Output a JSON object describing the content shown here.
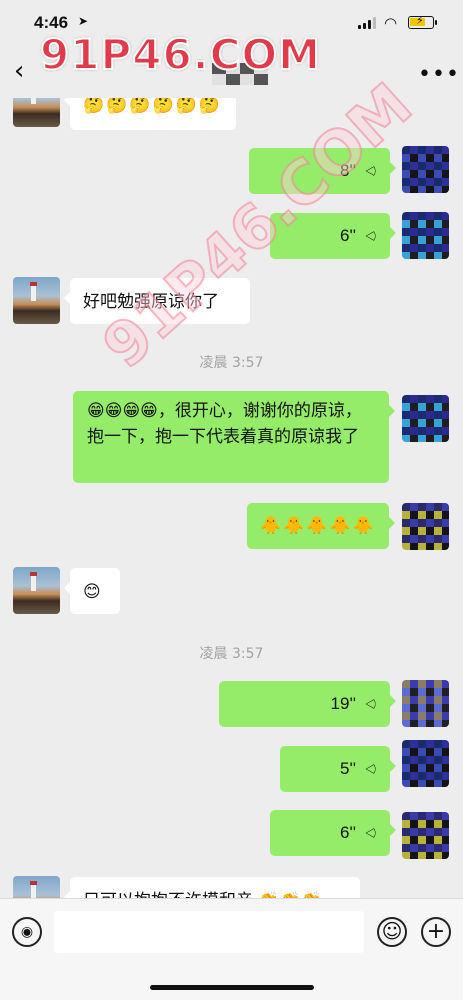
{
  "status_bar": {
    "time": "4:46",
    "location_icon": "location-arrow-icon",
    "wifi_icon": "wifi-icon",
    "battery_icon": "battery-charging-icon"
  },
  "nav": {
    "back_icon": "chevron-left-icon",
    "more_label": "•••",
    "back_label": "‹"
  },
  "watermark": {
    "main": "91P46.COM",
    "diagonal": "91P46.COM"
  },
  "messages": [
    {
      "side": "left",
      "type": "text",
      "text": "🤔🤔🤔🤔🤔🤔"
    },
    {
      "side": "right",
      "type": "voice",
      "duration": "8''"
    },
    {
      "side": "right",
      "type": "voice",
      "duration": "6''"
    },
    {
      "side": "left",
      "type": "text",
      "text": "好吧勉强原谅你了"
    },
    {
      "type": "timestamp",
      "text": "凌晨 3:57"
    },
    {
      "side": "right",
      "type": "text",
      "text": "😁😁😁😁，很开心，谢谢你的原谅，抱一下，抱一下代表着真的原谅我了"
    },
    {
      "side": "right",
      "type": "text",
      "text": "🐥🐥🐥🐥🐥"
    },
    {
      "side": "left",
      "type": "text",
      "text": "😊"
    },
    {
      "type": "timestamp",
      "text": "凌晨 3:57"
    },
    {
      "side": "right",
      "type": "voice",
      "duration": "19''"
    },
    {
      "side": "right",
      "type": "voice",
      "duration": "5''"
    },
    {
      "side": "right",
      "type": "voice",
      "duration": "6''"
    },
    {
      "side": "left",
      "type": "text",
      "text": "只可以抱抱不许摸和亲 👏👏👏"
    }
  ],
  "input_bar": {
    "voice_icon": "voice-input-icon",
    "emoji_icon": "emoji-icon",
    "plus_icon": "plus-icon",
    "emoji_label": "☺",
    "plus_label": "+",
    "voice_label": "◉"
  },
  "colors": {
    "background": "#ededed",
    "sent_bubble": "#95ec69",
    "received_bubble": "#ffffff",
    "timestamp": "#a3a3a3"
  }
}
